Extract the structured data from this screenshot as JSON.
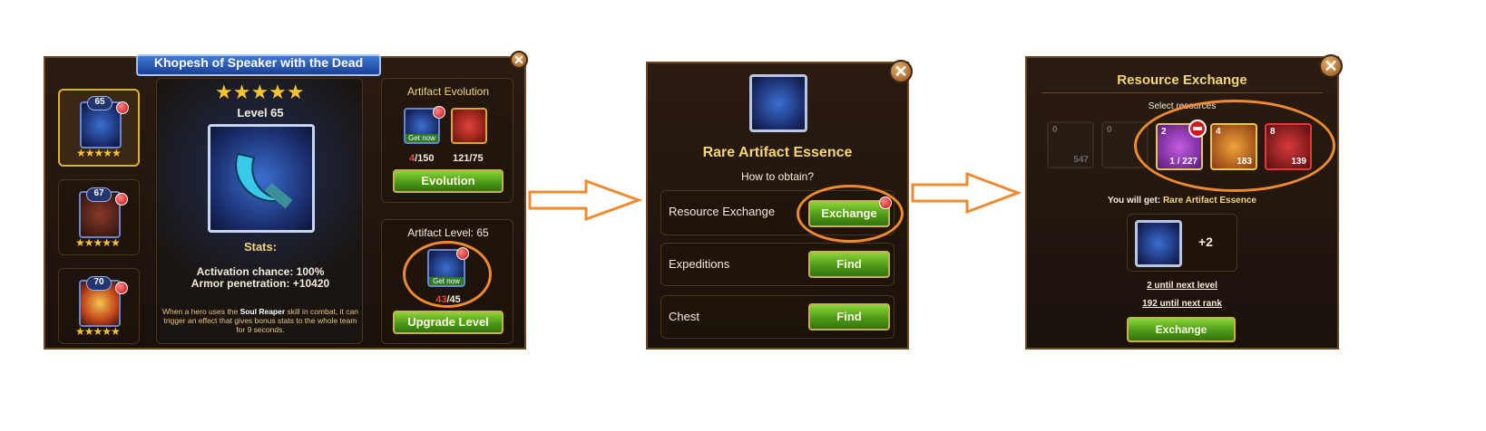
{
  "panel1": {
    "title": "Khopesh of Speaker with the Dead",
    "heroes": [
      {
        "level": "65",
        "stars": "★★★★★"
      },
      {
        "level": "67",
        "stars": "★★★★★"
      },
      {
        "level": "70",
        "stars": "★★★★★"
      }
    ],
    "big_stars": "★★★★★",
    "level_label": "Level 65",
    "stats_label": "Stats:",
    "stat1": "Activation chance: 100%",
    "stat2": "Armor penetration: +10420",
    "desc_pre": "When a hero uses the ",
    "desc_bold": "Soul Reaper",
    "desc_post": " skill in combat, it can trigger an effect that gives bonus stats to the whole team for 9 seconds.",
    "evolution_title": "Artifact Evolution",
    "get_now": "Get now",
    "evo_count1_cur": "4",
    "evo_count1_max": "/150",
    "evo_count2_cur": "121",
    "evo_count2_max": "/75",
    "evolution_btn": "Evolution",
    "artifact_level_title": "Artifact Level: 65",
    "get_now2": "Get now",
    "level_count_cur": "43",
    "level_count_max": "/45",
    "upgrade_btn": "Upgrade Level"
  },
  "panel2": {
    "title": "Rare Artifact Essence",
    "subtitle": "How to obtain?",
    "rows": [
      {
        "label": "Resource Exchange",
        "button": "Exchange"
      },
      {
        "label": "Expeditions",
        "button": "Find"
      },
      {
        "label": "Chest",
        "button": "Find"
      }
    ]
  },
  "panel3": {
    "title": "Resource Exchange",
    "select_label": "Select resources",
    "tiles": [
      {
        "top": "0",
        "bottom": "547"
      },
      {
        "top": "0",
        "bottom": ""
      },
      {
        "top": "2",
        "bottom": "1 / 227"
      },
      {
        "top": "4",
        "bottom": "183"
      },
      {
        "top": "8",
        "bottom": "139"
      }
    ],
    "you_will_get": "You will get: ",
    "you_will_get_item": "Rare Artifact Essence",
    "reward_amount": "+2",
    "until_level": "2 until next level",
    "until_rank": "192 until next rank",
    "exchange_btn": "Exchange"
  },
  "colors": {
    "accent": "#f08a2e",
    "gold": "#f4d774",
    "green": "#4d9a18"
  }
}
